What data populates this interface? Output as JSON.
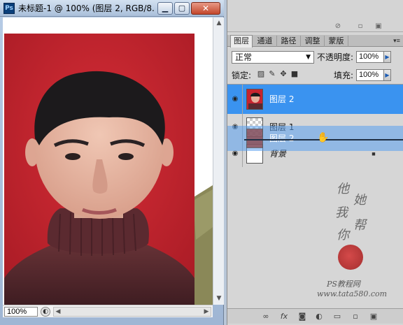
{
  "document_window": {
    "app_icon_label": "Ps",
    "title": "未标题-1 @ 100% (图层 2, RGB/8...",
    "buttons": {
      "minimize": "▁",
      "maximize": "▢",
      "close": "✕"
    },
    "zoom_level": "100%"
  },
  "layers_panel": {
    "tabs": [
      {
        "label": "图层",
        "active": true
      },
      {
        "label": "通道",
        "active": false
      },
      {
        "label": "路径",
        "active": false
      },
      {
        "label": "调整",
        "active": false
      },
      {
        "label": "蒙版",
        "active": false
      }
    ],
    "blend_mode": "正常",
    "opacity_label": "不透明度:",
    "opacity_value": "100%",
    "lock_label": "锁定:",
    "fill_label": "填充:",
    "fill_value": "100%",
    "layers": [
      {
        "name": "图层 2",
        "selected": true,
        "visible": true
      },
      {
        "name": "图层 1",
        "selected": false,
        "visible": true
      },
      {
        "name": "图层 2",
        "selected": false,
        "visible": true,
        "dragging": true
      },
      {
        "name": "背景",
        "selected": false,
        "visible": true,
        "locked": true
      }
    ]
  },
  "watermark": {
    "brush_text": [
      "他",
      "她",
      "我",
      "帮",
      "你"
    ],
    "site_line_1": "PS教程网",
    "site_line_2": "www.tata580.com"
  },
  "colors": {
    "selection_blue": "#3a93f0",
    "photo_background_red": "#c7242f",
    "sweater_maroon": "#5a2a30"
  }
}
